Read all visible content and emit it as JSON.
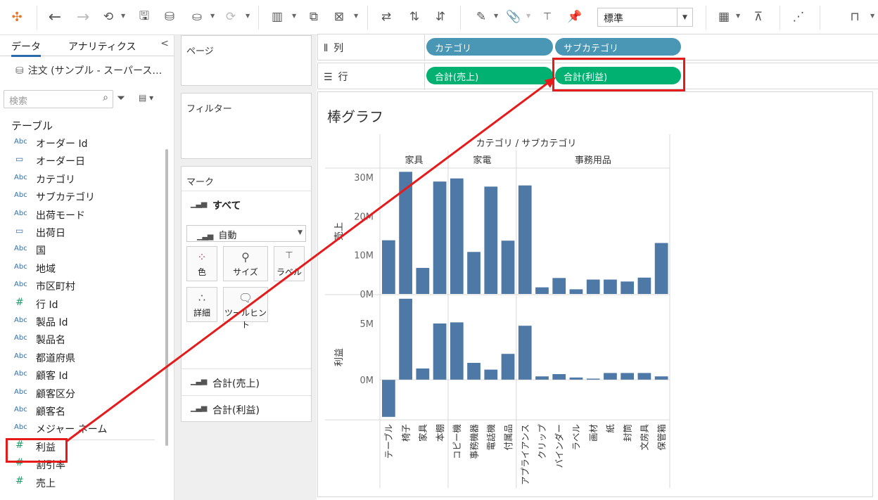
{
  "toolbar": {
    "fit_value": "標準"
  },
  "left_pane": {
    "tab_data": "データ",
    "tab_analytics": "アナリティクス",
    "datasource": "注文 (サンプル - スーパース…",
    "search_placeholder": "検索",
    "table_heading": "テーブル",
    "fields": [
      {
        "type": "Abc",
        "name": "オーダー Id"
      },
      {
        "type": "date",
        "name": "オーダー日"
      },
      {
        "type": "Abc",
        "name": "カテゴリ"
      },
      {
        "type": "Abc",
        "name": "サブカテゴリ"
      },
      {
        "type": "Abc",
        "name": "出荷モード"
      },
      {
        "type": "date",
        "name": "出荷日"
      },
      {
        "type": "Abc",
        "name": "国"
      },
      {
        "type": "Abc",
        "name": "地域"
      },
      {
        "type": "Abc",
        "name": "市区町村"
      },
      {
        "type": "#",
        "name": "行 Id"
      },
      {
        "type": "Abc",
        "name": "製品 Id"
      },
      {
        "type": "Abc",
        "name": "製品名"
      },
      {
        "type": "Abc",
        "name": "都道府県"
      },
      {
        "type": "Abc",
        "name": "顧客 Id"
      },
      {
        "type": "Abc",
        "name": "顧客区分"
      },
      {
        "type": "Abc",
        "name": "顧客名"
      },
      {
        "type": "Abc",
        "name": "メジャー ネーム"
      },
      {
        "type": "#",
        "name": "利益"
      },
      {
        "type": "#",
        "name": "割引率"
      },
      {
        "type": "#",
        "name": "売上"
      }
    ]
  },
  "mid_pane": {
    "pages_label": "ページ",
    "filters_label": "フィルター",
    "marks_label": "マーク",
    "marks_all": "すべて",
    "mark_type": "自動",
    "mark_buttons": [
      "色",
      "サイズ",
      "ラベル",
      "詳細",
      "ツールヒント"
    ],
    "measure_cards": [
      "合計(売上)",
      "合計(利益)"
    ]
  },
  "shelves": {
    "columns_label": "列",
    "rows_label": "行",
    "columns_pills": [
      "カテゴリ",
      "サブカテゴリ"
    ],
    "rows_pills": [
      "合計(売上)",
      "合計(利益)"
    ]
  },
  "view": {
    "sheet_title": "棒グラフ"
  },
  "chart_data": {
    "type": "bar",
    "title": "棒グラフ",
    "header_title": "カテゴリ / サブカテゴリ",
    "groups": [
      {
        "name": "家具",
        "categories": [
          "テーブル",
          "椅子",
          "家具",
          "本棚"
        ]
      },
      {
        "name": "家電",
        "categories": [
          "コピー機",
          "事務機器",
          "電話機",
          "付属品"
        ]
      },
      {
        "name": "事務用品",
        "categories": [
          "アプライアンス",
          "クリップ",
          "バインダー",
          "ラベル",
          "画材",
          "紙",
          "封筒",
          "文房具",
          "保管箱"
        ]
      }
    ],
    "categories": [
      "テーブル",
      "椅子",
      "家具",
      "本棚",
      "コピー機",
      "事務機器",
      "電話機",
      "付属品",
      "アプライアンス",
      "クリップ",
      "バインダー",
      "ラベル",
      "画材",
      "紙",
      "封筒",
      "文房具",
      "保管箱"
    ],
    "series": [
      {
        "name": "売上",
        "values": [
          13.8,
          31.4,
          6.7,
          28.9,
          29.7,
          10.8,
          27.6,
          13.7,
          27.9,
          1.7,
          4.1,
          1.2,
          3.7,
          3.7,
          3.2,
          4.2,
          13.1
        ],
        "ylim": [
          0,
          32
        ],
        "ticks": [
          "30M",
          "20M",
          "10M",
          "0M"
        ]
      },
      {
        "name": "利益",
        "values": [
          -3.3,
          7.2,
          1.0,
          5.0,
          5.1,
          1.5,
          0.9,
          2.3,
          4.8,
          0.3,
          0.5,
          0.2,
          0.1,
          0.6,
          0.6,
          0.6,
          0.3
        ],
        "ylim": [
          -3.5,
          7.5
        ],
        "ticks": [
          "5M",
          "0M"
        ]
      }
    ]
  }
}
